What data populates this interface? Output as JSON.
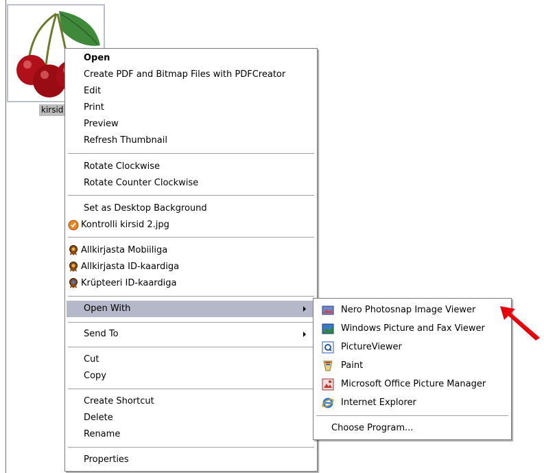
{
  "file": {
    "name": "kirsid"
  },
  "context_menu": {
    "items": [
      {
        "label": "Open"
      },
      {
        "label": "Create PDF and Bitmap Files with PDFCreator"
      },
      {
        "label": "Edit"
      },
      {
        "label": "Print"
      },
      {
        "label": "Preview"
      },
      {
        "label": "Refresh Thumbnail"
      },
      {
        "label": "Rotate Clockwise"
      },
      {
        "label": "Rotate Counter Clockwise"
      },
      {
        "label": "Set as Desktop Background"
      },
      {
        "label": "Kontrolli kirsid 2.jpg",
        "icon": "check-shield-icon"
      },
      {
        "label": "Allkirjasta Mobiiliga",
        "icon": "ribbon-badge-icon"
      },
      {
        "label": "Allkirjasta ID-kaardiga",
        "icon": "ribbon-badge-icon"
      },
      {
        "label": "Krüpteeri ID-kaardiga",
        "icon": "ribbon-badge-blue-icon"
      },
      {
        "label": "Open With"
      },
      {
        "label": "Send To"
      },
      {
        "label": "Cut"
      },
      {
        "label": "Copy"
      },
      {
        "label": "Create Shortcut"
      },
      {
        "label": "Delete"
      },
      {
        "label": "Rename"
      },
      {
        "label": "Properties"
      }
    ]
  },
  "open_with_menu": {
    "items": [
      {
        "label": "Nero Photosnap Image Viewer",
        "icon": "nero-photosnap-icon"
      },
      {
        "label": "Windows Picture and Fax Viewer",
        "icon": "picture-fax-viewer-icon"
      },
      {
        "label": "PictureViewer",
        "icon": "pictureviewer-icon"
      },
      {
        "label": "Paint",
        "icon": "paint-icon"
      },
      {
        "label": "Microsoft Office Picture Manager",
        "icon": "office-picture-manager-icon"
      },
      {
        "label": "Internet Explorer",
        "icon": "internet-explorer-icon"
      },
      {
        "label": "Choose Program..."
      }
    ]
  },
  "colors": {
    "highlight": "#b5b8c8",
    "annotation_arrow": "#e8000b"
  }
}
